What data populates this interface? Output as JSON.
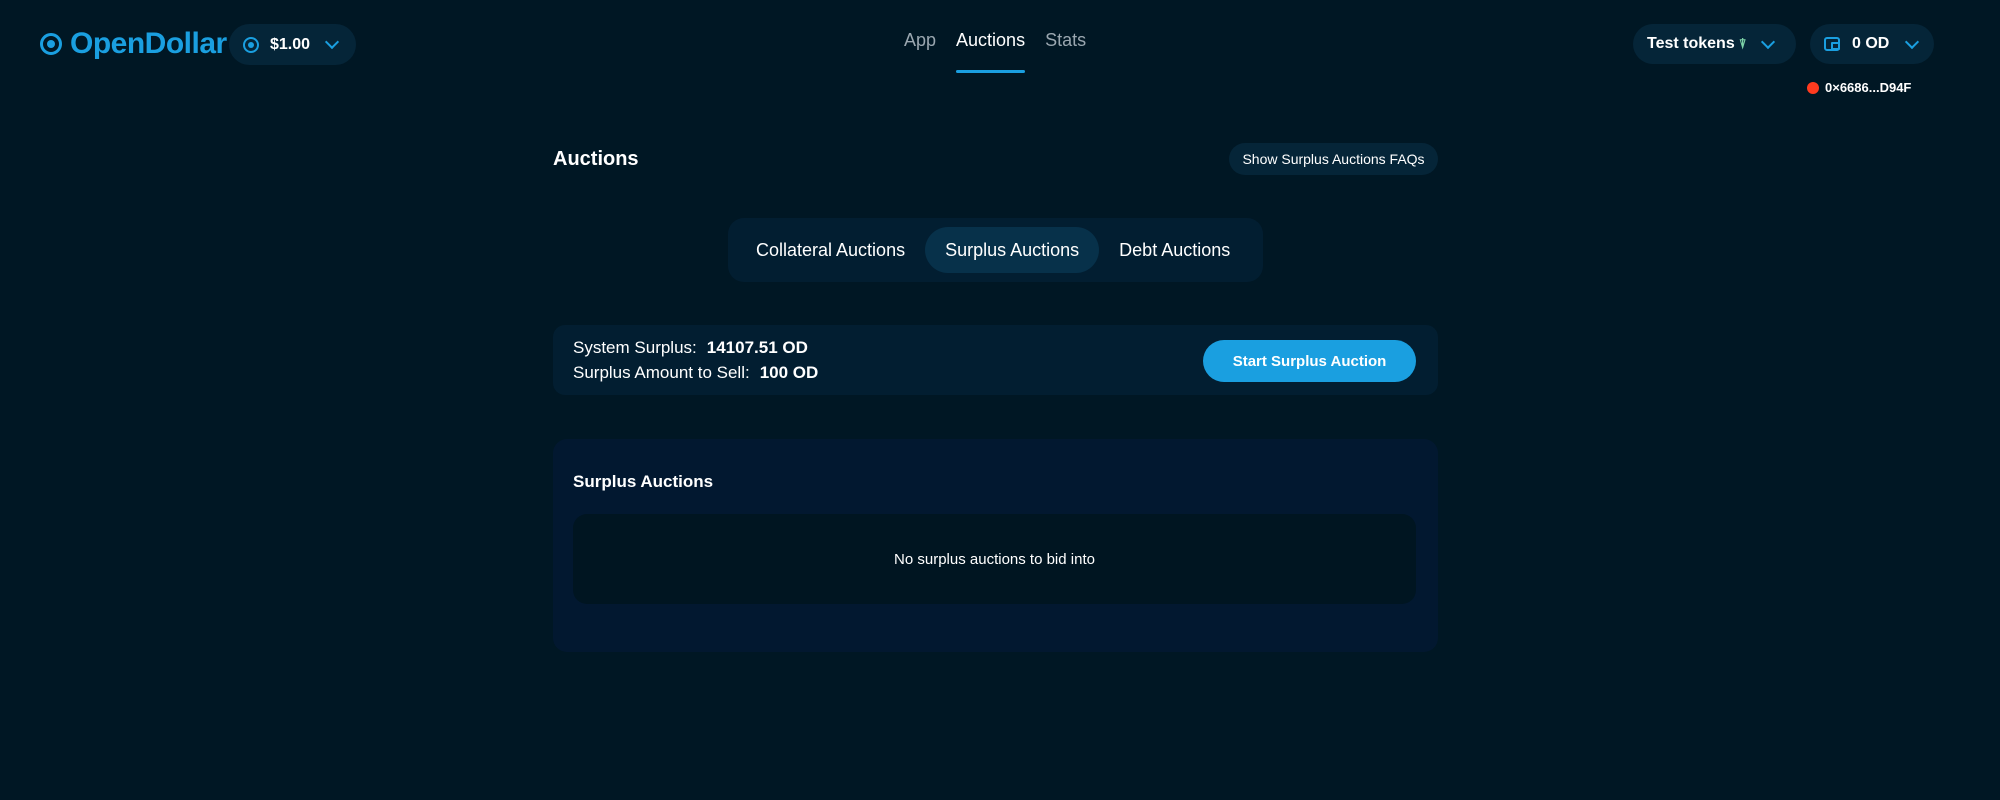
{
  "header": {
    "brand": "OpenDollar",
    "price": "$1.00",
    "nav": [
      {
        "label": "App",
        "active": false
      },
      {
        "label": "Auctions",
        "active": true
      },
      {
        "label": "Stats",
        "active": false
      }
    ],
    "test_tokens_label": "Test tokens",
    "test_tokens_icon": "faucet-icon",
    "wallet_balance": "0 OD",
    "wallet_icon": "wallet-icon",
    "address": "0×6686...D94F",
    "status_color": "#ff3b1f"
  },
  "main": {
    "title": "Auctions",
    "faq_button": "Show Surplus Auctions FAQs",
    "tabs": [
      {
        "label": "Collateral Auctions",
        "active": false
      },
      {
        "label": "Surplus Auctions",
        "active": true
      },
      {
        "label": "Debt Auctions",
        "active": false
      }
    ],
    "summary": {
      "system_surplus_label": "System Surplus:",
      "system_surplus_value": "14107.51 OD",
      "amount_to_sell_label": "Surplus Amount to Sell:",
      "amount_to_sell_value": "100 OD"
    },
    "start_button": "Start Surplus Auction",
    "panel": {
      "title": "Surplus Auctions",
      "empty_message": "No surplus auctions to bid into"
    }
  },
  "colors": {
    "background": "#001724",
    "accent": "#1a9fe0",
    "pill": "#052538",
    "card": "#021e31"
  }
}
